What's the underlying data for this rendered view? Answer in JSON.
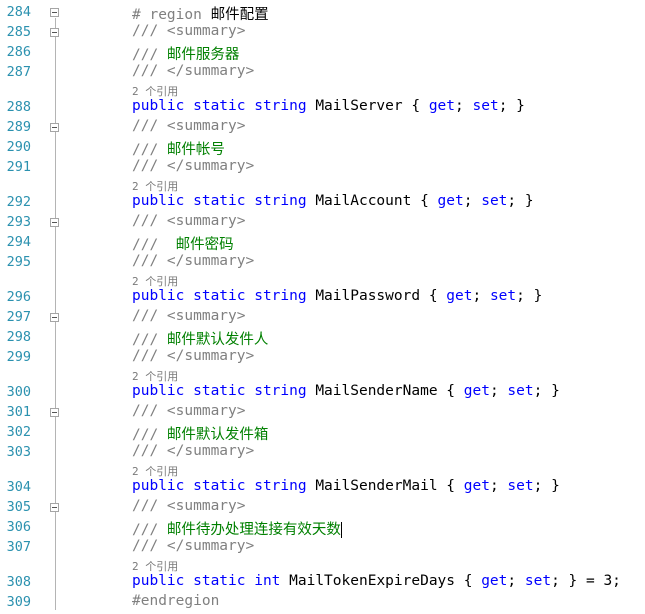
{
  "editor": {
    "lines": [
      {
        "n": "284",
        "tokens": [
          {
            "c": "pp",
            "t": "# region "
          },
          {
            "c": "tx",
            "t": "邮件配置"
          }
        ]
      },
      {
        "n": "285",
        "tokens": [
          {
            "c": "xdoc",
            "t": "/// <summary>"
          }
        ]
      },
      {
        "n": "286",
        "tokens": [
          {
            "c": "xdoc",
            "t": "/// "
          },
          {
            "c": "cmt",
            "t": "邮件服务器"
          }
        ]
      },
      {
        "n": "287",
        "tokens": [
          {
            "c": "xdoc",
            "t": "/// </summary>"
          }
        ]
      },
      {
        "lens": "2 个引用"
      },
      {
        "n": "288",
        "tokens": [
          {
            "c": "kw",
            "t": "public static string "
          },
          {
            "c": "tx",
            "t": "MailServer { "
          },
          {
            "c": "kw",
            "t": "get"
          },
          {
            "c": "tx",
            "t": "; "
          },
          {
            "c": "kw",
            "t": "set"
          },
          {
            "c": "tx",
            "t": "; }"
          }
        ]
      },
      {
        "n": "289",
        "tokens": [
          {
            "c": "xdoc",
            "t": "/// <summary>"
          }
        ]
      },
      {
        "n": "290",
        "tokens": [
          {
            "c": "xdoc",
            "t": "/// "
          },
          {
            "c": "cmt",
            "t": "邮件帐号"
          }
        ]
      },
      {
        "n": "291",
        "tokens": [
          {
            "c": "xdoc",
            "t": "/// </summary>"
          }
        ]
      },
      {
        "lens": "2 个引用"
      },
      {
        "n": "292",
        "tokens": [
          {
            "c": "kw",
            "t": "public static string "
          },
          {
            "c": "tx",
            "t": "MailAccount { "
          },
          {
            "c": "kw",
            "t": "get"
          },
          {
            "c": "tx",
            "t": "; "
          },
          {
            "c": "kw",
            "t": "set"
          },
          {
            "c": "tx",
            "t": "; }"
          }
        ]
      },
      {
        "n": "293",
        "tokens": [
          {
            "c": "xdoc",
            "t": "/// <summary>"
          }
        ]
      },
      {
        "n": "294",
        "tokens": [
          {
            "c": "xdoc",
            "t": "/// "
          },
          {
            "c": "cmt",
            "t": " 邮件密码"
          }
        ]
      },
      {
        "n": "295",
        "tokens": [
          {
            "c": "xdoc",
            "t": "/// </summary>"
          }
        ]
      },
      {
        "lens": "2 个引用"
      },
      {
        "n": "296",
        "tokens": [
          {
            "c": "kw",
            "t": "public static string "
          },
          {
            "c": "tx",
            "t": "MailPassword { "
          },
          {
            "c": "kw",
            "t": "get"
          },
          {
            "c": "tx",
            "t": "; "
          },
          {
            "c": "kw",
            "t": "set"
          },
          {
            "c": "tx",
            "t": "; }"
          }
        ]
      },
      {
        "n": "297",
        "tokens": [
          {
            "c": "xdoc",
            "t": "/// <summary>"
          }
        ]
      },
      {
        "n": "298",
        "tokens": [
          {
            "c": "xdoc",
            "t": "/// "
          },
          {
            "c": "cmt",
            "t": "邮件默认发件人"
          }
        ]
      },
      {
        "n": "299",
        "tokens": [
          {
            "c": "xdoc",
            "t": "/// </summary>"
          }
        ]
      },
      {
        "lens": "2 个引用"
      },
      {
        "n": "300",
        "tokens": [
          {
            "c": "kw",
            "t": "public static string "
          },
          {
            "c": "tx",
            "t": "MailSenderName { "
          },
          {
            "c": "kw",
            "t": "get"
          },
          {
            "c": "tx",
            "t": "; "
          },
          {
            "c": "kw",
            "t": "set"
          },
          {
            "c": "tx",
            "t": "; }"
          }
        ]
      },
      {
        "n": "301",
        "tokens": [
          {
            "c": "xdoc",
            "t": "/// <summary>"
          }
        ]
      },
      {
        "n": "302",
        "tokens": [
          {
            "c": "xdoc",
            "t": "/// "
          },
          {
            "c": "cmt",
            "t": "邮件默认发件箱"
          }
        ]
      },
      {
        "n": "303",
        "tokens": [
          {
            "c": "xdoc",
            "t": "/// </summary>"
          }
        ]
      },
      {
        "lens": "2 个引用"
      },
      {
        "n": "304",
        "tokens": [
          {
            "c": "kw",
            "t": "public static string "
          },
          {
            "c": "tx",
            "t": "MailSenderMail { "
          },
          {
            "c": "kw",
            "t": "get"
          },
          {
            "c": "tx",
            "t": "; "
          },
          {
            "c": "kw",
            "t": "set"
          },
          {
            "c": "tx",
            "t": "; }"
          }
        ]
      },
      {
        "n": "305",
        "tokens": [
          {
            "c": "xdoc",
            "t": "/// <summary>"
          }
        ]
      },
      {
        "n": "306",
        "tokens": [
          {
            "c": "xdoc",
            "t": "/// "
          },
          {
            "c": "cmt",
            "t": "邮件待办处理连接有效天数"
          }
        ],
        "caret": true
      },
      {
        "n": "307",
        "tokens": [
          {
            "c": "xdoc",
            "t": "/// </summary>"
          }
        ]
      },
      {
        "lens": "2 个引用"
      },
      {
        "n": "308",
        "tokens": [
          {
            "c": "kw",
            "t": "public static int "
          },
          {
            "c": "tx",
            "t": "MailTokenExpireDays { "
          },
          {
            "c": "kw",
            "t": "get"
          },
          {
            "c": "tx",
            "t": "; "
          },
          {
            "c": "kw",
            "t": "set"
          },
          {
            "c": "tx",
            "t": "; } = 3;"
          }
        ]
      },
      {
        "n": "309",
        "tokens": [
          {
            "c": "pp",
            "t": "#endregion"
          }
        ]
      }
    ]
  }
}
